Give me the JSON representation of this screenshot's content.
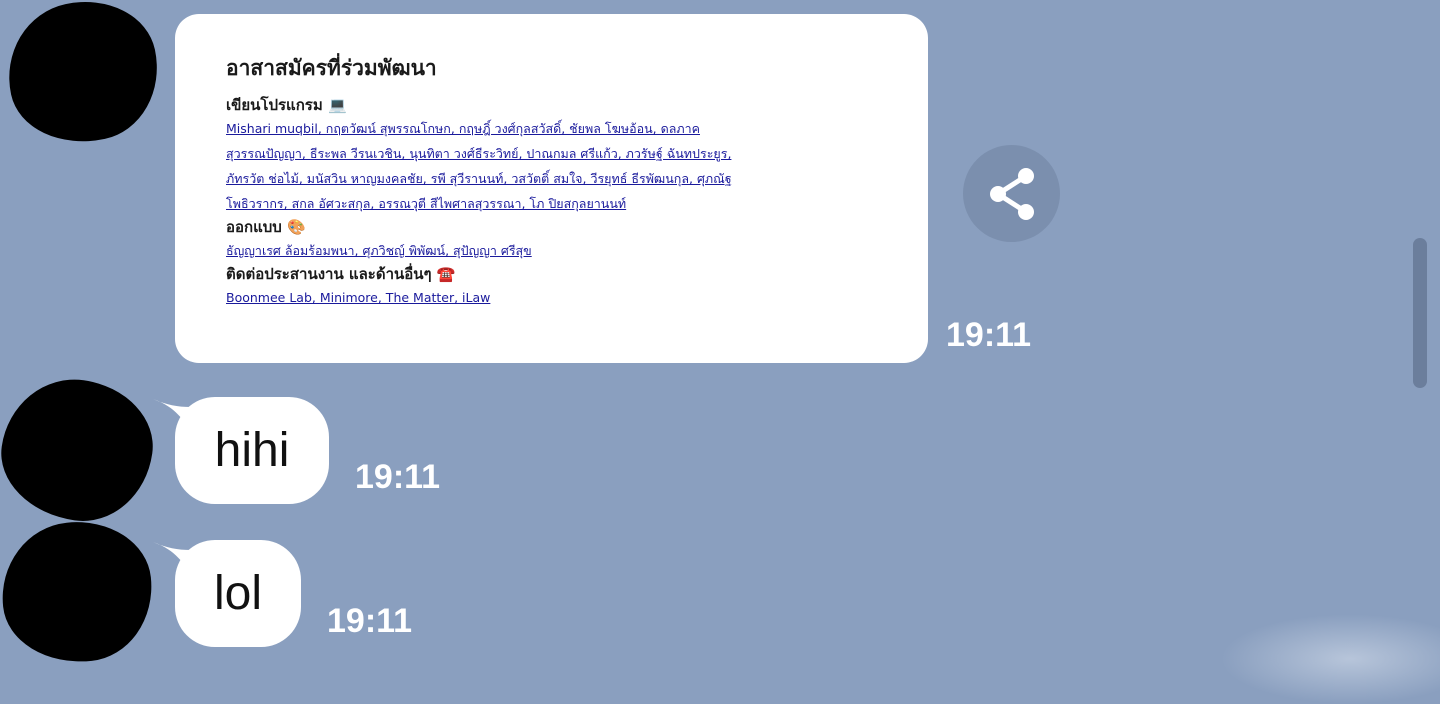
{
  "messages": [
    {
      "type": "card",
      "card": {
        "title": "อาสาสมัครที่ร่วมพัฒนา",
        "sections": [
          {
            "heading": "เขียนโปรแกรม 💻",
            "lines": [
              "Mishari muqbil, กฤตวัฒน์ สุพรรณโกษก, กฤษฎิ์ วงศ์กุลสวัสดิ์, ชัยพล โฆษอ้อน, ดลภาค",
              "สุวรรณปัญญา, ธีระพล วีรนเวชิน, นุนทิตา วงศ์ธีระวิทย์, ปาณกมล ศรีแก้ว, ภวรัษฐ์ ฉันทประยูร,",
              "ภัทรวัต ช่อไม้, มนัสวิน หาญมงคลชัย, รพี สุวีรานนท์, วสวัตติ์ สมใจ, วีรยุทธ์ ธีรพัฒนกุล, ศุภณัฐ",
              "โพธิวรากร, สกล อัศวะสกุล, อรรณวุตี สีไพศาลสุวรรณา, โภ ปิยสกุลยานนท์"
            ]
          },
          {
            "heading": "ออกแบบ 🎨",
            "lines": [
              "ธัญญาเรศ ล้อมร้อมพนา, ศุภวิชญ์ พิพัฒน์, สุปัญญา ศรีสุข"
            ]
          },
          {
            "heading": "ติดต่อประสานงาน และด้านอื่นๆ ☎️",
            "lines": [
              "Boonmee Lab, Minimore, The Matter, iLaw"
            ]
          }
        ]
      },
      "time": "19:11"
    },
    {
      "type": "text",
      "text": "hihi",
      "time": "19:11"
    },
    {
      "type": "text",
      "text": "lol",
      "time": "19:11"
    }
  ],
  "share_button": {
    "icon": "share-icon"
  },
  "colors": {
    "background": "#8a9fbf",
    "bubble": "#ffffff",
    "link": "#1a1a9c",
    "timestamp": "#ffffff"
  }
}
